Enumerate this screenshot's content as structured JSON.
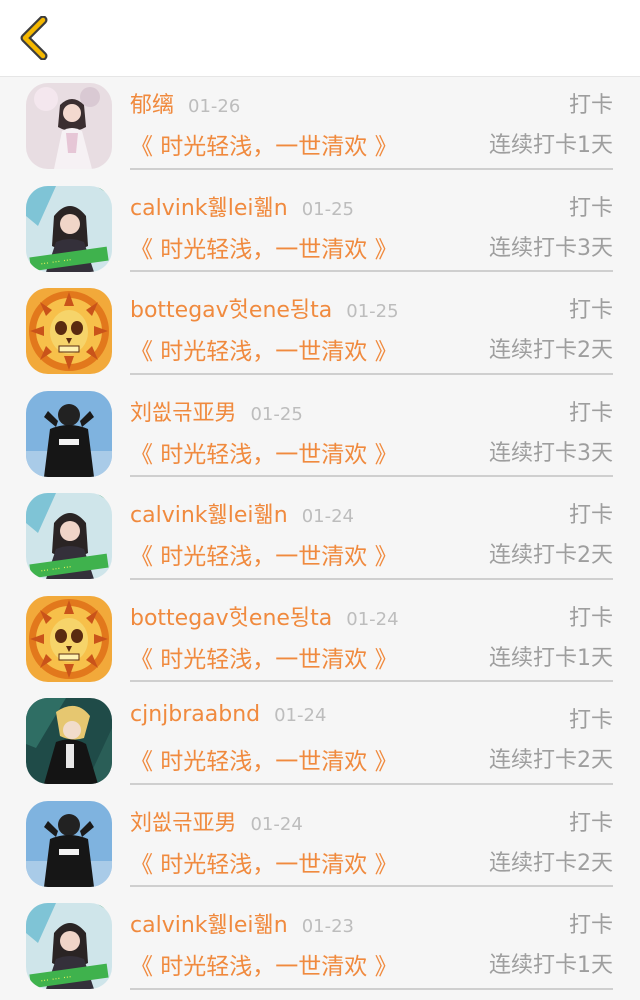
{
  "header": {
    "back_icon": "chevron-left-icon",
    "accent": "#f5b800"
  },
  "colors": {
    "name": "#f08a3e",
    "muted": "#9e9e9e",
    "date": "#bdbdbd"
  },
  "records": [
    {
      "name": "郁缡",
      "date": "01-26",
      "action": "打卡",
      "group": "《 时光轻浅，一世清欢 》",
      "streak": "连续打卡1天",
      "avatar": "girl-traditional"
    },
    {
      "name": "calvink휋lei휆n",
      "date": "01-25",
      "action": "打卡",
      "group": "《 时光轻浅，一世清欢 》",
      "streak": "连续打卡3天",
      "avatar": "girl-green"
    },
    {
      "name": "bottegav헛ene됭ta",
      "date": "01-25",
      "action": "打卡",
      "group": "《 时光轻浅，一世清欢 》",
      "streak": "连续打卡2天",
      "avatar": "lion-skull"
    },
    {
      "name": "刘씞귺亚男",
      "date": "01-25",
      "action": "打卡",
      "group": "《 时光轻浅，一世清欢 》",
      "streak": "连续打卡3天",
      "avatar": "boy-jacket"
    },
    {
      "name": "calvink휋lei휆n",
      "date": "01-24",
      "action": "打卡",
      "group": "《 时光轻浅，一世清欢 》",
      "streak": "连续打卡2天",
      "avatar": "girl-green"
    },
    {
      "name": "bottegav헛ene됭ta",
      "date": "01-24",
      "action": "打卡",
      "group": "《 时光轻浅，一世清欢 》",
      "streak": "连续打卡1天",
      "avatar": "lion-skull"
    },
    {
      "name": "cjnjbraabnd",
      "date": "01-24",
      "action": "打卡",
      "group": "《 时光轻浅，一世清欢 》",
      "streak": "连续打卡2天",
      "avatar": "anime-boy"
    },
    {
      "name": "刘씞귺亚男",
      "date": "01-24",
      "action": "打卡",
      "group": "《 时光轻浅，一世清欢 》",
      "streak": "连续打卡2天",
      "avatar": "boy-jacket"
    },
    {
      "name": "calvink휋lei휆n",
      "date": "01-23",
      "action": "打卡",
      "group": "《 时光轻浅，一世清欢 》",
      "streak": "连续打卡1天",
      "avatar": "girl-green"
    }
  ]
}
